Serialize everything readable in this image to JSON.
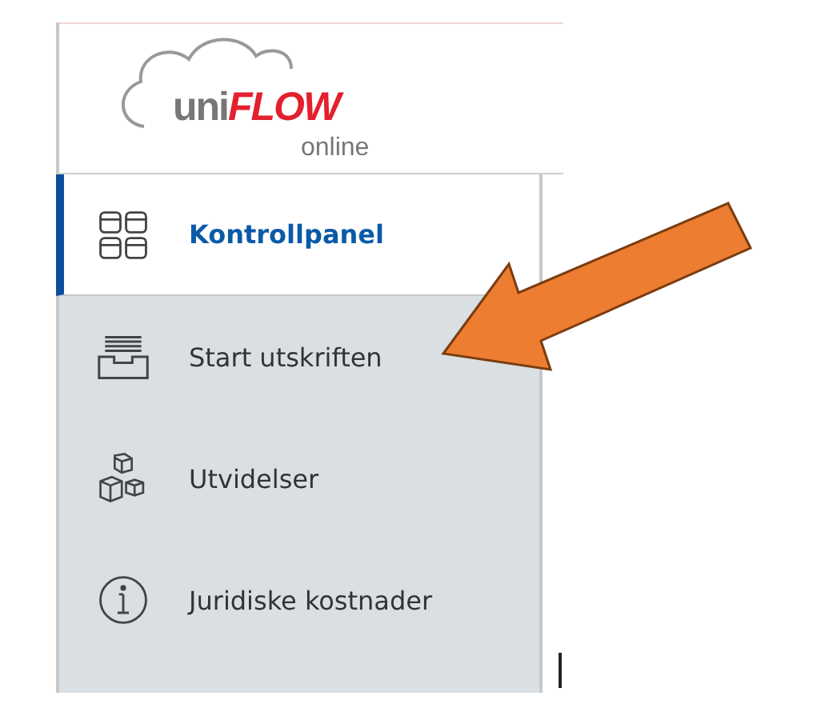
{
  "logo": {
    "prefix": "uni",
    "brand": "FLOW",
    "suffix": "online"
  },
  "sidebar": {
    "items": [
      {
        "kind": "dashboard",
        "label": "Kontrollpanel",
        "selected": true
      },
      {
        "kind": "print",
        "label": "Start utskriften",
        "selected": false
      },
      {
        "kind": "extensions",
        "label": "Utvidelser",
        "selected": false
      },
      {
        "kind": "info",
        "label": "Juridiske kostnader",
        "selected": false
      }
    ]
  }
}
